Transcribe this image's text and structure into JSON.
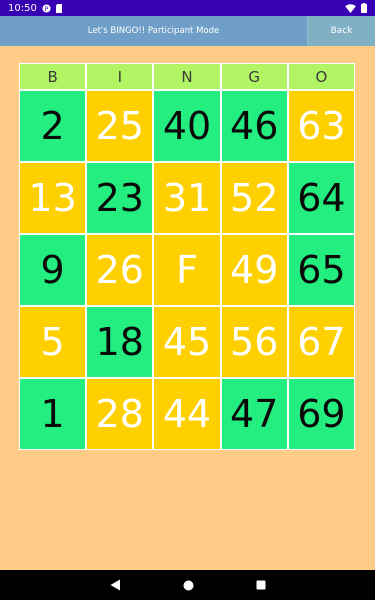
{
  "status_bar": {
    "time": "10:50",
    "icons": [
      "app-notification-icon",
      "sd-card-icon",
      "wifi-icon",
      "battery-icon"
    ]
  },
  "app_bar": {
    "title": "Let's BINGO!! Participant Mode",
    "back_label": "Back"
  },
  "board": {
    "headers": [
      "B",
      "I",
      "N",
      "G",
      "O"
    ],
    "rows": [
      [
        "2",
        "25",
        "40",
        "46",
        "63"
      ],
      [
        "13",
        "23",
        "31",
        "52",
        "64"
      ],
      [
        "9",
        "26",
        "F",
        "49",
        "65"
      ],
      [
        "5",
        "18",
        "45",
        "56",
        "67"
      ],
      [
        "1",
        "28",
        "44",
        "47",
        "69"
      ]
    ],
    "cell_states": [
      [
        "green",
        "yellow",
        "green",
        "green",
        "yellow"
      ],
      [
        "yellow",
        "green",
        "yellow",
        "yellow",
        "green"
      ],
      [
        "green",
        "yellow",
        "yellow",
        "yellow",
        "green"
      ],
      [
        "yellow",
        "green",
        "yellow",
        "yellow",
        "yellow"
      ],
      [
        "green",
        "yellow",
        "yellow",
        "green",
        "green"
      ]
    ]
  },
  "colors": {
    "background": "#ffcc88",
    "app_bar": "#6f9fc8",
    "back_button": "#7fb0c4",
    "header_cell": "#b2f564",
    "green_cell": "#24ee80",
    "yellow_cell": "#ffd000",
    "status_bar": "#3700b3"
  },
  "nav_bar": {
    "icons": [
      "back-triangle-icon",
      "home-circle-icon",
      "recents-square-icon"
    ]
  }
}
